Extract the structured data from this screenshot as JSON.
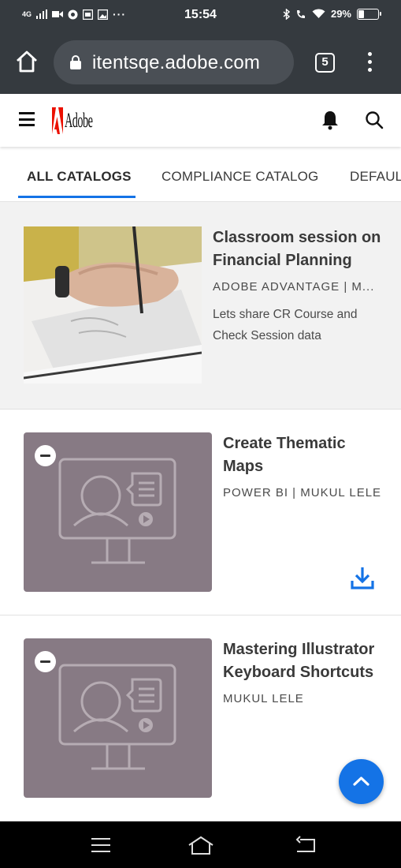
{
  "status_bar": {
    "network": "4G",
    "time": "15:54",
    "battery_percent": "29%",
    "battery_level": 0.29,
    "icons": [
      "signal-icon",
      "video-icon",
      "chrome-icon",
      "screenshot-icon",
      "image-icon",
      "more-icon",
      "bluetooth-icon",
      "wifi-call-icon",
      "wifi-icon",
      "battery-icon"
    ]
  },
  "browser": {
    "url": "itentsqe.adobe.com",
    "tab_count": "5"
  },
  "header": {
    "logo_text": "Adobe"
  },
  "tabs": [
    {
      "label": "ALL CATALOGS",
      "active": true
    },
    {
      "label": "COMPLIANCE CATALOG",
      "active": false
    },
    {
      "label": "DEFAULT",
      "active": false
    }
  ],
  "cards": [
    {
      "title_line1": "Classroom session on",
      "title_line2": "Financial Planning",
      "meta": "ADOBE ADVANTAGE | M...",
      "desc_line1": "Lets share CR Course and",
      "desc_line2": "Check Session data"
    },
    {
      "title_line1": "Create Thematic",
      "title_line2": "Maps",
      "meta": "POWER BI | MUKUL LELE"
    },
    {
      "title_line1": "Mastering Illustrator",
      "title_line2": "Keyboard Shortcuts",
      "meta": "MUKUL LELE"
    }
  ],
  "colors": {
    "accent": "#1473e6",
    "status_bar": "#353a3f",
    "tile": "#877a84",
    "adobe_red": "#eb1000"
  }
}
